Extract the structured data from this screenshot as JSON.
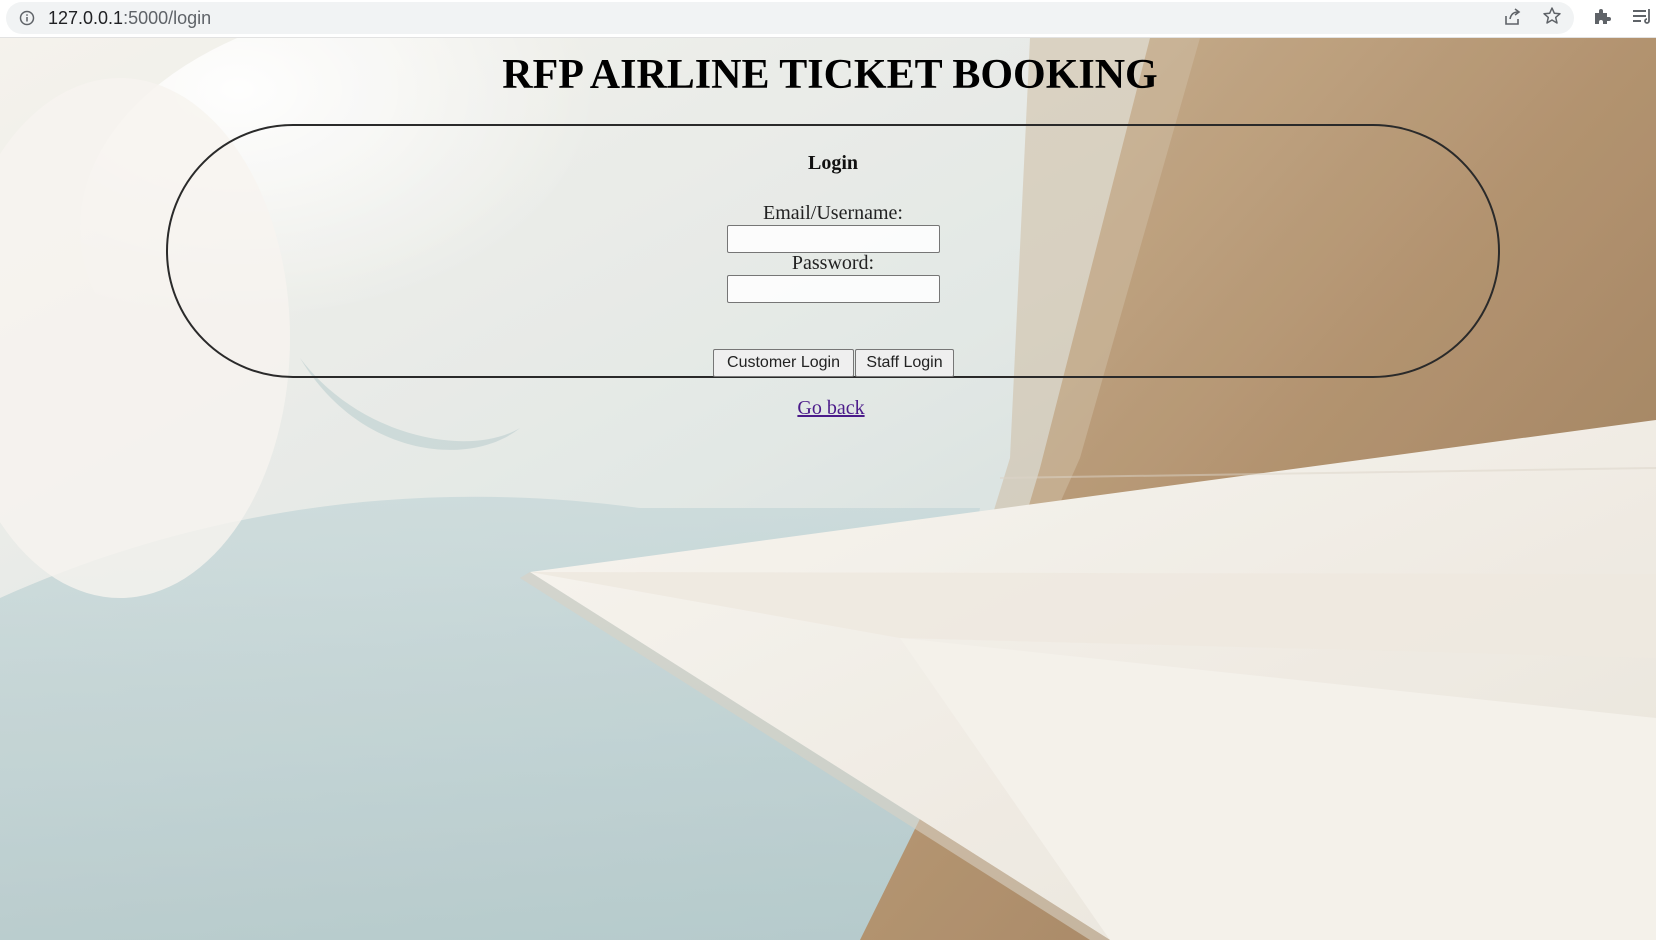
{
  "browser": {
    "url_host": "127.0.0.1",
    "url_path": ":5000/login"
  },
  "page": {
    "title": "RFP AIRLINE TICKET BOOKING"
  },
  "login_form": {
    "heading": "Login",
    "email_label": "Email/Username:",
    "email_value": "",
    "password_label": "Password:",
    "password_value": "",
    "customer_login_label": "Customer Login",
    "staff_login_label": "Staff Login"
  },
  "links": {
    "go_back": "Go back"
  }
}
